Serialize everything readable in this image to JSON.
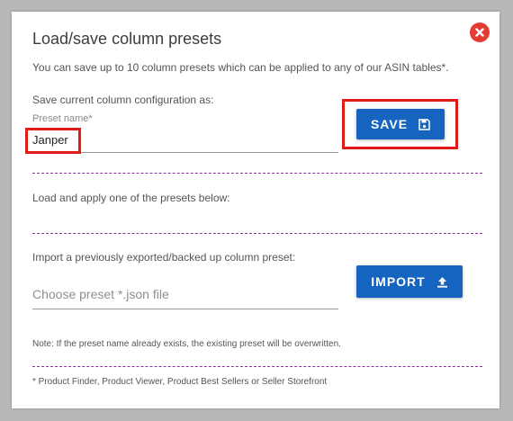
{
  "dialog": {
    "title": "Load/save column presets",
    "intro": "You can save up to 10 column presets which can be applied to any of our ASIN tables*.",
    "save_section": {
      "heading": "Save current column configuration as:",
      "field_label": "Preset name*",
      "field_value": "Janper",
      "button_label": "SAVE"
    },
    "load_section": {
      "heading": "Load and apply one of the presets below:"
    },
    "import_section": {
      "heading": "Import a previously exported/backed up column preset:",
      "file_placeholder": "Choose preset *.json file",
      "button_label": "IMPORT"
    },
    "note": "Note: If the preset name already exists, the existing preset will be overwritten.",
    "footnote": "* Product Finder, Product Viewer, Product Best Sellers or Seller Storefront"
  },
  "colors": {
    "accent": "#1565c0",
    "close": "#e43b32",
    "highlight": "#e01919",
    "divider": "#8a2f9e"
  }
}
